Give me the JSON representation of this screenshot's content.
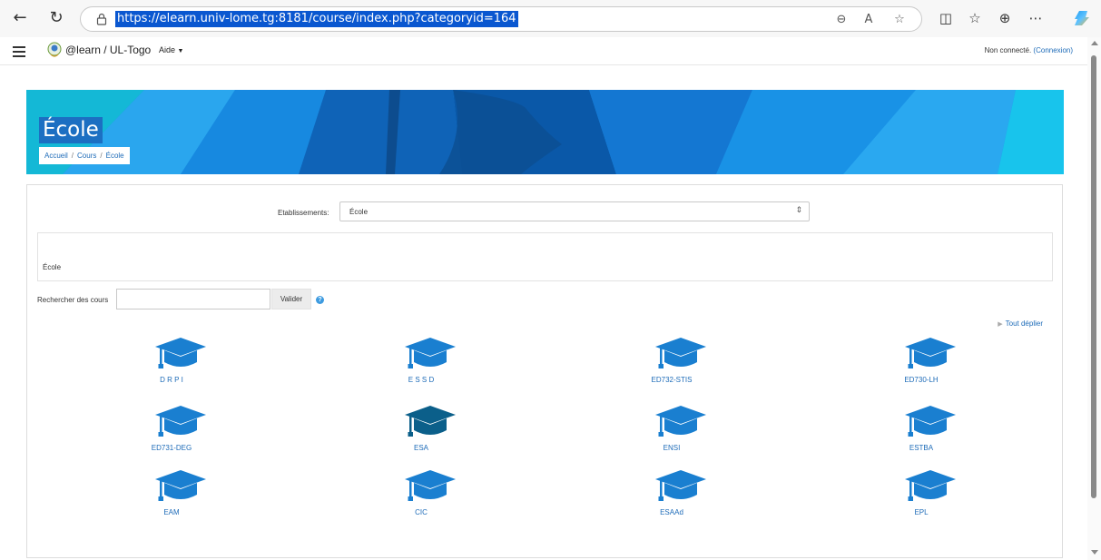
{
  "browser": {
    "url": "https://elearn.univ-lome.tg:8181/course/index.php?categoryid=164",
    "nav_icons": [
      "back-arrow-icon",
      "reload-icon",
      "lock-icon"
    ],
    "toolbar_icons": [
      "zoom-out-icon",
      "read-aloud-icon",
      "favorite-star-icon",
      "split-screen-icon",
      "favorites-icon",
      "collections-icon",
      "more-icon",
      "copilot-icon"
    ]
  },
  "site": {
    "brand": "@learn / UL-Togo",
    "help_menu": "Aide",
    "login_status": "Non connecté.",
    "login_link": "(Connexion)"
  },
  "header": {
    "title": "École",
    "breadcrumbs": [
      "Accueil",
      "Cours",
      "École"
    ]
  },
  "filters": {
    "category_label": "Etablissements:",
    "category_value": "École"
  },
  "description": "École",
  "search": {
    "label": "Rechercher des cours",
    "value": "",
    "button": "Valider"
  },
  "expand_all": "Tout déplier",
  "categories": [
    {
      "name": "D R P I"
    },
    {
      "name": "E S S D"
    },
    {
      "name": "ED732-STIS"
    },
    {
      "name": "ED730-LH"
    },
    {
      "name": "ED731-DEG"
    },
    {
      "name": "ESA"
    },
    {
      "name": "ENSI"
    },
    {
      "name": "ESTBA"
    },
    {
      "name": "EAM"
    },
    {
      "name": "CIC"
    },
    {
      "name": "ESAAd"
    },
    {
      "name": "EPL"
    }
  ],
  "colors": {
    "link": "#1d6bb8",
    "cap_icon": "#1a7fd0",
    "cap_icon_active": "#0b5f8a",
    "heading_bg": "#1c6fc2"
  }
}
